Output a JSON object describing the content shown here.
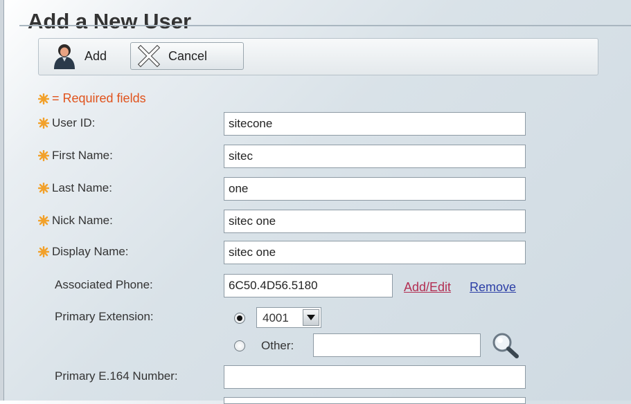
{
  "page": {
    "title": "Add a New User"
  },
  "toolbar": {
    "add_label": "Add",
    "cancel_label": "Cancel"
  },
  "legend": {
    "text": "= Required fields"
  },
  "fields": {
    "user_id": {
      "label": "User ID:",
      "value": "sitecone"
    },
    "first_name": {
      "label": "First Name:",
      "value": "sitec"
    },
    "last_name": {
      "label": "Last Name:",
      "value": "one"
    },
    "nick_name": {
      "label": "Nick Name:",
      "value": "sitec one"
    },
    "display_name": {
      "label": "Display Name:",
      "value": "sitec one"
    },
    "associated_phone": {
      "label": "Associated Phone:",
      "value": "6C50.4D56.5180",
      "add_edit": "Add/Edit",
      "remove": "Remove"
    },
    "primary_extension": {
      "label": "Primary Extension:",
      "selected": "4001",
      "other_label": "Other:",
      "other_value": ""
    },
    "primary_e164": {
      "label": "Primary E.164 Number:",
      "value": ""
    }
  },
  "colors": {
    "required": "#e0531c",
    "link_add_edit": "#b22e52",
    "link_remove": "#2c3fa6",
    "required_icon": "#f2a12a"
  }
}
